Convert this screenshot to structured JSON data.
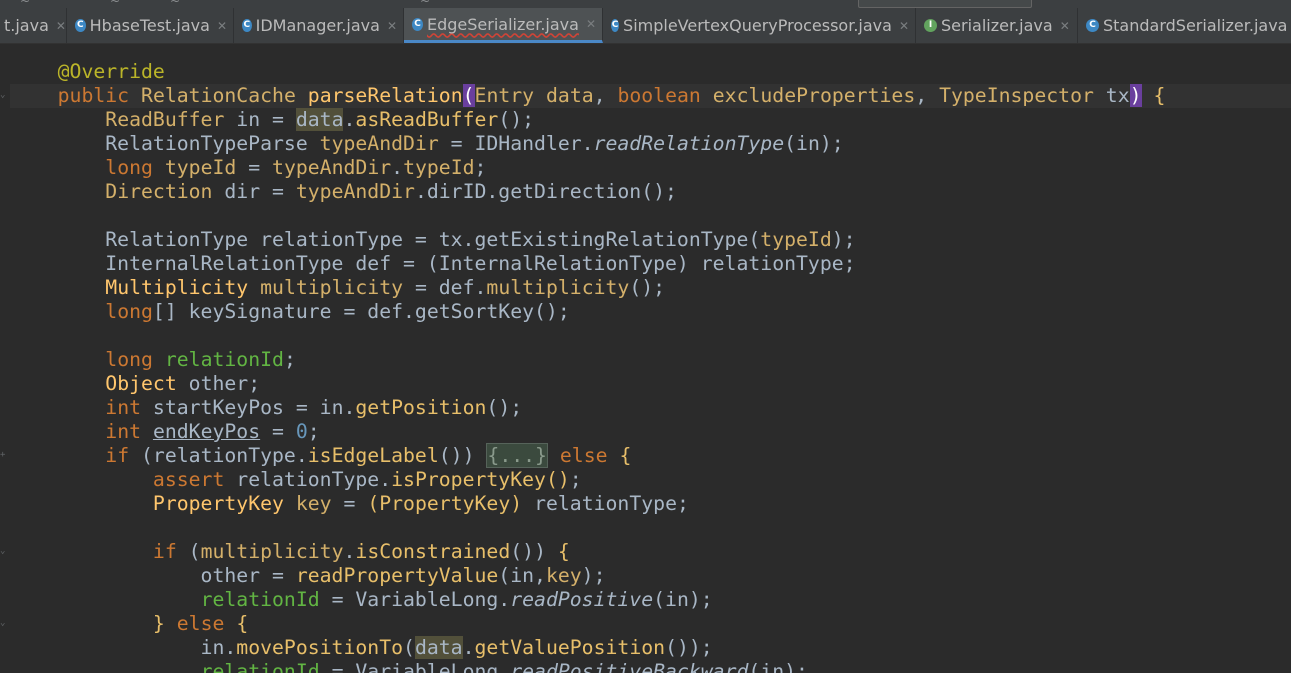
{
  "tabs": [
    {
      "label": "t.java",
      "icon": "none",
      "active": false
    },
    {
      "label": "HbaseTest.java",
      "icon": "java-class-icon",
      "active": false
    },
    {
      "label": "IDManager.java",
      "icon": "java-class-icon",
      "active": false
    },
    {
      "label": "EdgeSerializer.java",
      "icon": "java-class-icon",
      "active": true
    },
    {
      "label": "SimpleVertexQueryProcessor.java",
      "icon": "java-class-icon",
      "active": false
    },
    {
      "label": "Serializer.java",
      "icon": "java-interface-icon",
      "active": false
    },
    {
      "label": "StandardSerializer.java",
      "icon": "java-class-icon",
      "active": false
    }
  ],
  "colors": {
    "background": "#2b2b2b",
    "keyword": "#cc7832",
    "method": "#ffc66d",
    "annotation": "#bbb529",
    "number": "#6897bb",
    "default_text": "#a9b7c6",
    "active_tab_underline": "#4a88c7"
  },
  "code_lines": [
    "    @Override",
    "    public RelationCache parseRelation(Entry data, boolean excludeProperties, TypeInspector tx) {",
    "        ReadBuffer in = data.asReadBuffer();",
    "        RelationTypeParse typeAndDir = IDHandler.readRelationType(in);",
    "        long typeId = typeAndDir.typeId;",
    "        Direction dir = typeAndDir.dirID.getDirection();",
    "",
    "        RelationType relationType = tx.getExistingRelationType(typeId);",
    "        InternalRelationType def = (InternalRelationType) relationType;",
    "        Multiplicity multiplicity = def.multiplicity();",
    "        long[] keySignature = def.getSortKey();",
    "",
    "        long relationId;",
    "        Object other;",
    "        int startKeyPos = in.getPosition();",
    "        int endKeyPos = 0;",
    "        if (relationType.isEdgeLabel()) {...} else {",
    "            assert relationType.isPropertyKey();",
    "            PropertyKey key = (PropertyKey) relationType;",
    "",
    "            if (multiplicity.isConstrained()) {",
    "                other = readPropertyValue(in,key);",
    "                relationId = VariableLong.readPositive(in);",
    "            } else {",
    "                in.movePositionTo(data.getValuePosition());",
    "                relationId = VariableLong.readPositiveBackward(in);"
  ]
}
